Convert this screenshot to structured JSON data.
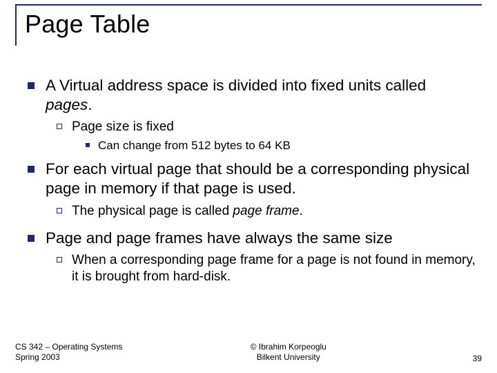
{
  "title": "Page Table",
  "b1_a": "A Virtual address space is divided into fixed units called ",
  "b1_b": "pages",
  "b1_c": ".",
  "b1_1": "Page size is fixed",
  "b1_1_1": "Can change from 512 bytes to 64 KB",
  "b2": "For each virtual page that should be a corresponding physical page in memory if that page is used.",
  "b2_1_a": "The physical page is called ",
  "b2_1_b": "page frame",
  "b2_1_c": ".",
  "b3": "Page and page frames have always the same size",
  "b3_1": "When a corresponding page frame for a page is not found in memory, it is brought from hard-disk.",
  "footer_left_1": "CS 342 – Operating Systems",
  "footer_left_2": "Spring 2003",
  "footer_center_1": "© Ibrahim Korpeoglu",
  "footer_center_2": "Bilkent University",
  "footer_right": "39"
}
